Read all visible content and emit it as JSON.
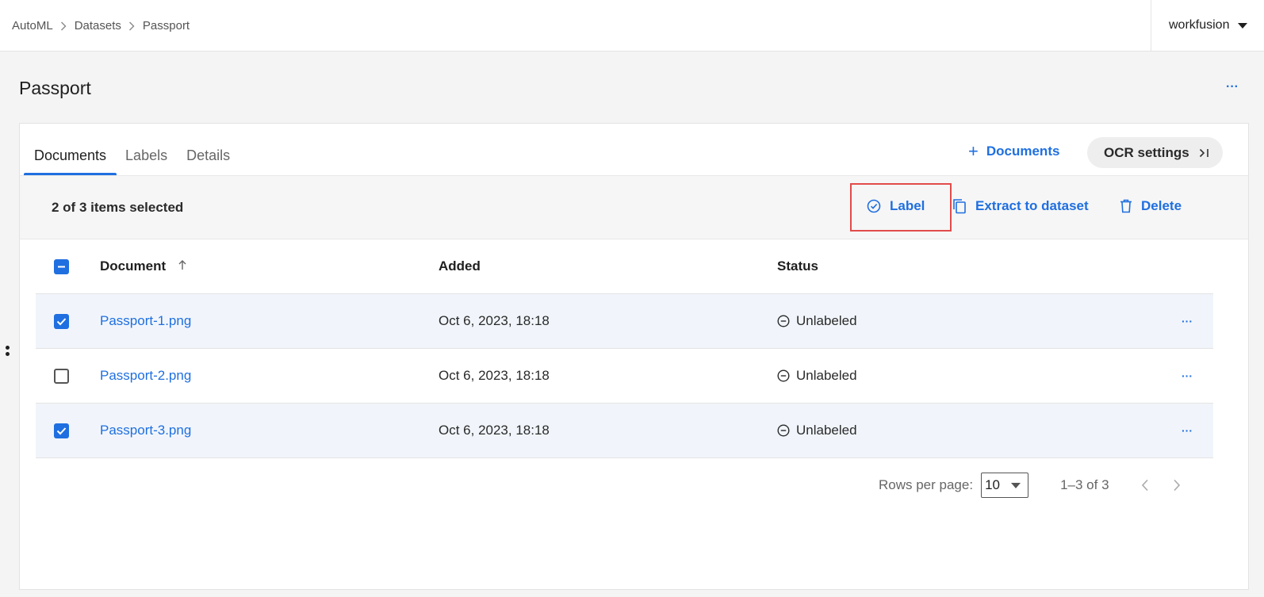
{
  "breadcrumb": [
    "AutoML",
    "Datasets",
    "Passport"
  ],
  "user": {
    "name": "workfusion"
  },
  "page": {
    "title": "Passport",
    "more": "···"
  },
  "tabs": [
    {
      "label": "Documents",
      "active": true
    },
    {
      "label": "Labels",
      "active": false
    },
    {
      "label": "Details",
      "active": false
    }
  ],
  "toolbar": {
    "add_documents_label": "Documents",
    "ocr_settings_label": "OCR settings"
  },
  "selection": {
    "count_text": "2 of 3 items selected",
    "actions": {
      "label": "Label",
      "extract": "Extract to dataset",
      "delete": "Delete"
    }
  },
  "table": {
    "columns": [
      "Document",
      "Added",
      "Status"
    ],
    "rows": [
      {
        "document": "Passport-1.png",
        "added": "Oct 6, 2023, 18:18",
        "status": "Unlabeled",
        "selected": true
      },
      {
        "document": "Passport-2.png",
        "added": "Oct 6, 2023, 18:18",
        "status": "Unlabeled",
        "selected": false
      },
      {
        "document": "Passport-3.png",
        "added": "Oct 6, 2023, 18:18",
        "status": "Unlabeled",
        "selected": true
      }
    ],
    "row_more": "···"
  },
  "pagination": {
    "rows_per_page_label": "Rows per page:",
    "rows_per_page_value": "10",
    "range_text": "1–3 of 3"
  },
  "colors": {
    "accent": "#1f6fe0",
    "highlight": "#e24b4b"
  }
}
